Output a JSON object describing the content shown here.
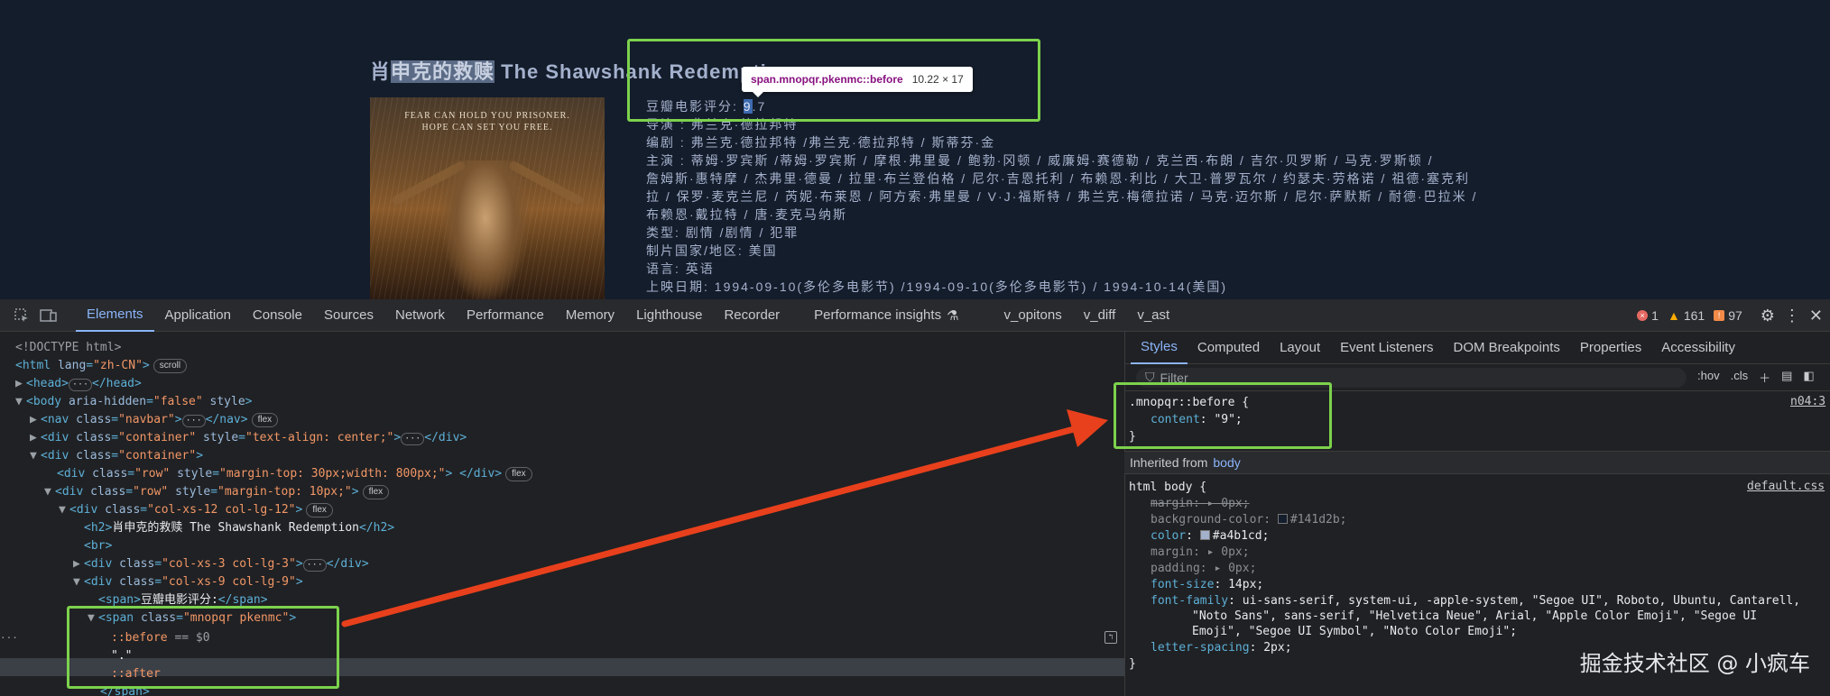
{
  "page": {
    "title_before": "肖",
    "title_selected": "申克的救赎",
    "title_after": " The Shawshank Redemption",
    "poster_tagline_1": "FEAR CAN HOLD YOU PRISONER.",
    "poster_tagline_2": "HOPE CAN SET YOU FREE.",
    "rating_label": "豆瓣电影评分: ",
    "rating_first": "9",
    "rating_rest": ".7",
    "lines": [
      "导演  : 弗兰克·德拉邦特",
      "编剧  : 弗兰克·德拉邦特    /弗兰克·德拉邦特 / 斯蒂芬·金",
      "主演  : 蒂姆·罗宾斯    /蒂姆·罗宾斯 / 摩根·弗里曼 / 鲍勃·冈顿 / 威廉姆·赛德勒 / 克兰西·布朗 / 吉尔·贝罗斯 / 马克·罗斯顿 /",
      "詹姆斯·惠特摩 / 杰弗里·德曼 / 拉里·布兰登伯格 / 尼尔·吉恩托利 / 布赖恩·利比 / 大卫·普罗瓦尔 / 约瑟夫·劳格诺 / 祖德·塞克利",
      "拉 / 保罗·麦克兰尼 / 芮妮·布莱恩 / 阿方索·弗里曼 / V·J·福斯特 / 弗兰克·梅德拉诺 / 马克·迈尔斯 / 尼尔·萨默斯 / 耐德·巴拉米 /",
      "布赖恩·戴拉特 / 唐·麦克马纳斯",
      "类型:  剧情    /剧情 / 犯罪",
      "制片国家/地区:  美国",
      "语言:  英语",
      "上映日期:  1994-09-10(多伦多电影节)    /1994-09-10(多伦多电影节) / 1994-10-14(美国)"
    ]
  },
  "tooltip": {
    "selector": "span.mnopqr.pkenmc::before",
    "size": "10.22 × 17"
  },
  "devtools": {
    "tabs": [
      "Elements",
      "Application",
      "Console",
      "Sources",
      "Network",
      "Performance",
      "Memory",
      "Lighthouse",
      "Recorder",
      "Performance insights",
      "v_opitons",
      "v_diff",
      "v_ast"
    ],
    "active_tab": "Elements",
    "errors": "1",
    "warnings": "161",
    "issues": "97",
    "styles_tabs": [
      "Styles",
      "Computed",
      "Layout",
      "Event Listeners",
      "DOM Breakpoints",
      "Properties",
      "Accessibility"
    ],
    "filter_placeholder": "Filter",
    "hov": ":hov",
    "cls": ".cls",
    "rule1_selector": ".mnopqr::before {",
    "rule1_prop": "content",
    "rule1_val": "\"9\";",
    "rule1_src": "n04:3",
    "inherited_label": "Inherited from",
    "inherited_from": "body",
    "rule2_selector": "html body {",
    "rule2_src": "default.css",
    "rule2_props": [
      {
        "p": "margin",
        "v": "▸ 0px;",
        "struck": true
      },
      {
        "p": "background-color",
        "v": "#141d2b;",
        "dim": true,
        "swatch": "#141d2b"
      },
      {
        "p": "color",
        "v": "#a4b1cd;",
        "swatch": "#a4b1cd"
      },
      {
        "p": "margin",
        "v": "▸ 0px;",
        "dim": true
      },
      {
        "p": "padding",
        "v": "▸ 0px;",
        "dim": true
      },
      {
        "p": "font-size",
        "v": "14px;"
      },
      {
        "p": "font-family",
        "v": "ui-sans-serif, system-ui, -apple-system, \"Segoe UI\", Roboto, Ubuntu, Cantarell,"
      },
      {
        "p": "",
        "v": "\"Noto Sans\", sans-serif, \"Helvetica Neue\", Arial, \"Apple Color Emoji\", \"Segoe UI"
      },
      {
        "p": "",
        "v": "Emoji\", \"Segoe UI Symbol\", \"Noto Color Emoji\";"
      },
      {
        "p": "letter-spacing",
        "v": "2px;"
      }
    ],
    "dom": {
      "doctype": "<!DOCTYPE html>",
      "html_attr_val": "\"zh-CN\"",
      "scroll_pill": "scroll",
      "flex_pill": "flex",
      "body_attr_val": "\"false\"",
      "nav_class": "\"navbar\"",
      "container_style": "\"text-align: center;\"",
      "row1_style": "\"margin-top: 30px;width: 800px;\"",
      "row2_style": "\"margin-top: 10px;\"",
      "col12_class": "\"col-xs-12 col-lg-12\"",
      "h2_text": "肖申克的救赎 The Shawshank Redemption",
      "col3_class": "\"col-xs-3 col-lg-3\"",
      "col9_class": "\"col-xs-9 col-lg-9\"",
      "span_text": "豆瓣电影评分:",
      "span_class": "\"mnopqr pkenmc\"",
      "before": "::before",
      "eq": " == $0",
      "dot_text": "\".\"",
      "after": "::after"
    }
  },
  "watermark": "掘金技术社区 @ 小疯车"
}
